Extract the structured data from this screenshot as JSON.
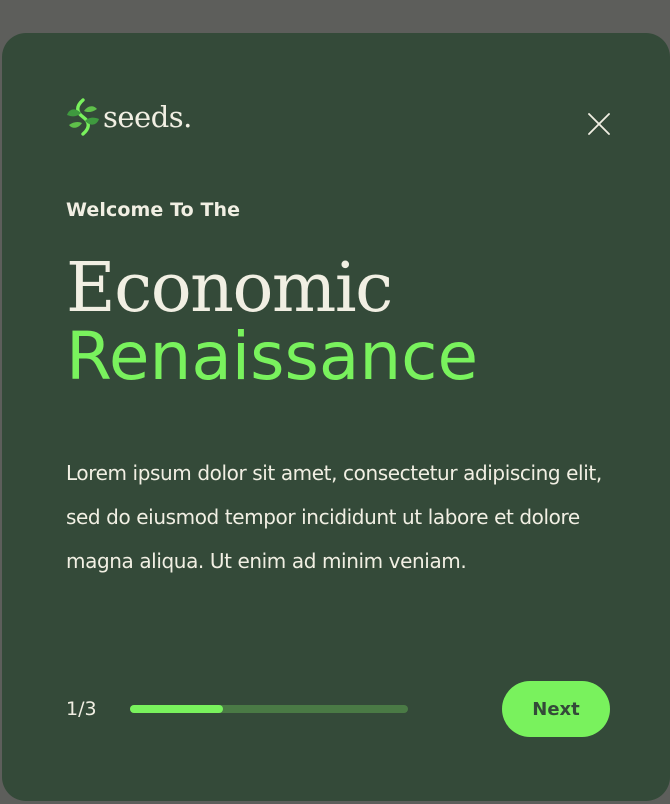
{
  "logo": {
    "text": "seeds.",
    "icon": "seeds-logo-icon"
  },
  "close": {
    "icon": "close-icon"
  },
  "header": {
    "eyebrow": "Welcome To The",
    "title_line1": "Economic",
    "title_line2": "Renaissance"
  },
  "body": {
    "text": "Lorem ipsum dolor sit amet, consectetur adipiscing elit, sed do eiusmod tempor incididunt ut labore et dolore magna aliqua. Ut enim ad minim veniam."
  },
  "pagination": {
    "label": "1/3",
    "current": 1,
    "total": 3,
    "progress": 0.333
  },
  "actions": {
    "next_label": "Next"
  },
  "colors": {
    "backdrop": "#5d5e5b",
    "panel": "#344a39",
    "accent": "#79f25d",
    "text": "#f1efe3",
    "track": "#4a7a45"
  }
}
